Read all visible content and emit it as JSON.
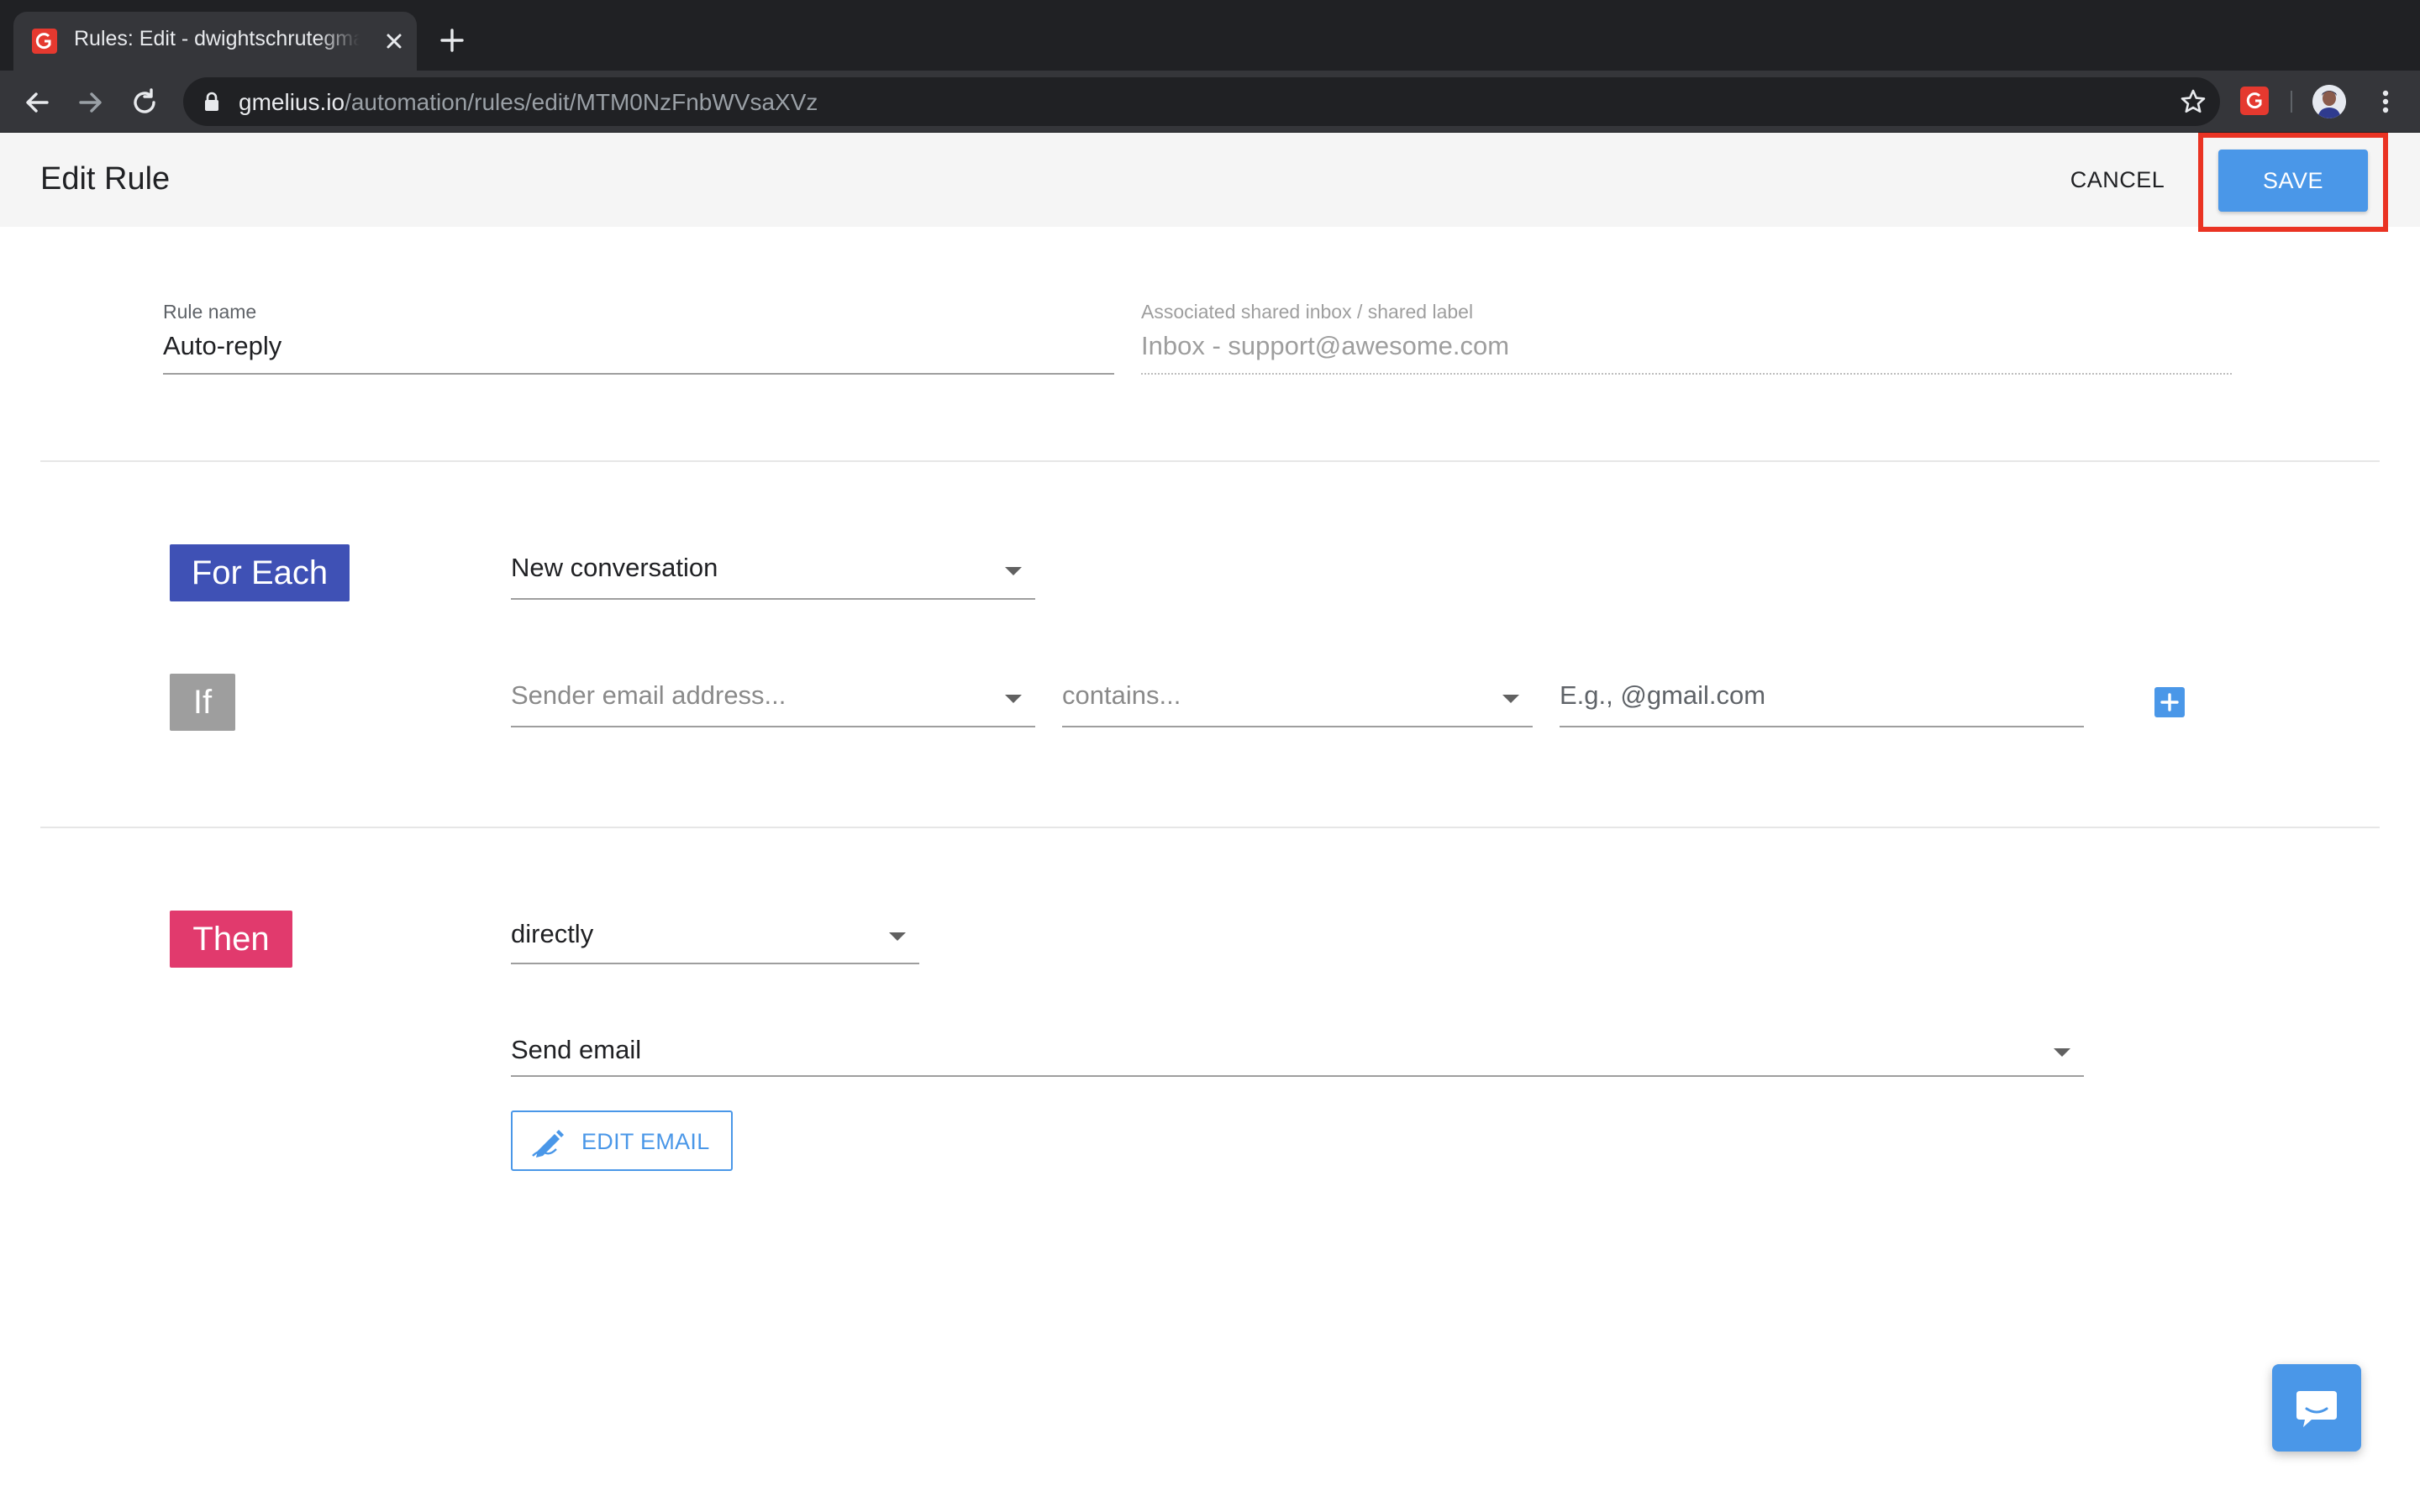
{
  "browser": {
    "tab_title": "Rules: Edit - dwightschrutegmail",
    "url_host": "gmelius.io",
    "url_path": "/automation/rules/edit/MTM0NzFnbWVsaXVz"
  },
  "header": {
    "title": "Edit Rule",
    "cancel_label": "CANCEL",
    "save_label": "SAVE"
  },
  "rule": {
    "name_label": "Rule name",
    "name_value": "Auto-reply",
    "inbox_label": "Associated shared inbox / shared label",
    "inbox_value": "Inbox - support@awesome.com"
  },
  "trigger": {
    "for_each_label": "For Each",
    "for_each_value": "New conversation",
    "if_label": "If",
    "condition_field_placeholder": "Sender email address...",
    "condition_operator_placeholder": "contains...",
    "condition_value_placeholder": "E.g., @gmail.com"
  },
  "action": {
    "then_label": "Then",
    "timing_value": "directly",
    "action_value": "Send email",
    "edit_email_label": "EDIT EMAIL"
  },
  "colors": {
    "accent_blue": "#4a97e8",
    "for_each_badge": "#3f51b5",
    "if_badge": "#9e9e9e",
    "then_badge": "#e13a6d",
    "highlight_red": "#ea3323"
  },
  "icons": {
    "favicon": "gmelius-favicon-icon",
    "tab_close": "close-icon",
    "new_tab": "plus-icon",
    "back": "arrow-back-icon",
    "forward": "arrow-forward-icon",
    "reload": "reload-icon",
    "lock": "lock-icon",
    "bookmark": "star-icon",
    "extension": "gmelius-extension-icon",
    "menu": "more-vert-icon",
    "add_condition": "plus-square-icon",
    "edit_email": "edit-pen-icon",
    "chat": "chat-bubble-icon"
  }
}
